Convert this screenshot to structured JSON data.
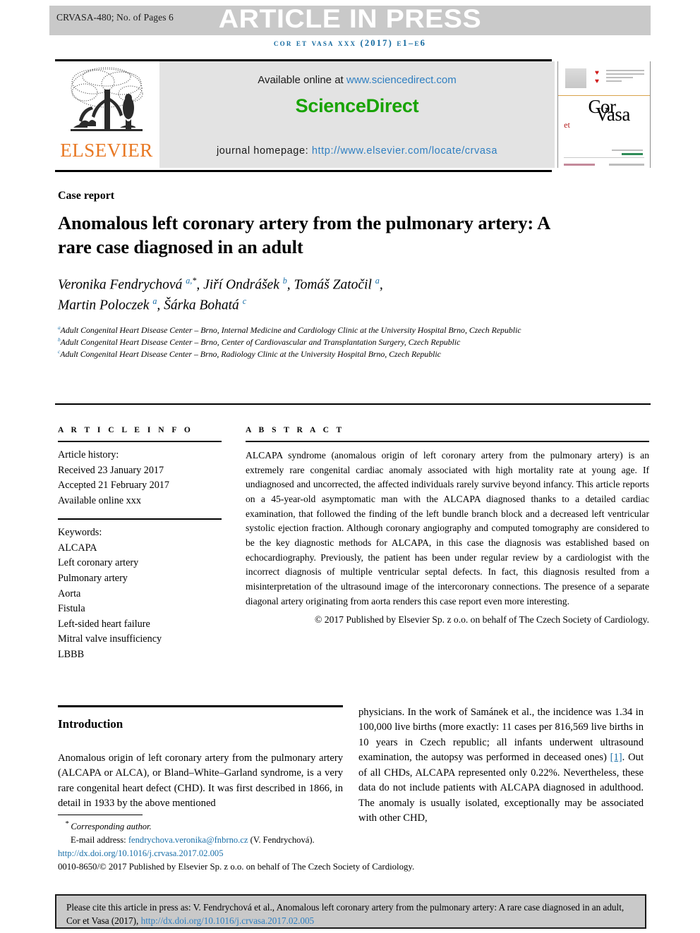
{
  "banner": {
    "article_id": "CRVASA-480; No. of Pages 6",
    "press_text": "ARTICLE IN PRESS",
    "journal_line": "COR ET VASA XXX (2017) e1–e6"
  },
  "masthead": {
    "publisher": "ELSEVIER",
    "available_prefix": "Available online at ",
    "available_url": "www.sciencedirect.com",
    "sciencedirect": "ScienceDirect",
    "homepage_label": "journal homepage: ",
    "homepage_url": "http://www.elsevier.com/locate/crvasa",
    "cover": {
      "cor": "Cor",
      "et": "et",
      "vasa": "Vasa"
    }
  },
  "article": {
    "type": "Case report",
    "title": "Anomalous left coronary artery from the pulmonary artery: A rare case diagnosed in an adult",
    "authors_line1_a": "Veronika Fendrychová ",
    "authors_line1_b": ", Jiří Ondrášek ",
    "authors_line1_c": ", Tomáš Zatočil ",
    "authors_line2_a": "Martin Poloczek ",
    "authors_line2_b": ", Šárka Bohatá ",
    "affiliations": [
      "Adult Congenital Heart Disease Center – Brno, Internal Medicine and Cardiology Clinic at the University Hospital Brno, Czech Republic",
      "Adult Congenital Heart Disease Center – Brno, Center of Cardiovascular and Transplantation Surgery, Czech Republic",
      "Adult Congenital Heart Disease Center – Brno, Radiology Clinic at the University Hospital Brno, Czech Republic"
    ]
  },
  "info": {
    "heading": "A R T I C L E   I N F O",
    "history_label": "Article history:",
    "received": "Received 23 January 2017",
    "accepted": "Accepted 21 February 2017",
    "available": "Available online xxx",
    "keywords_label": "Keywords:",
    "keywords": [
      "ALCAPA",
      "Left coronary artery",
      "Pulmonary artery",
      "Aorta",
      "Fistula",
      "Left-sided heart failure",
      "Mitral valve insufficiency",
      "LBBB"
    ]
  },
  "abstract": {
    "heading": "A B S T R A C T",
    "body": "ALCAPA syndrome (anomalous origin of left coronary artery from the pulmonary artery) is an extremely rare congenital cardiac anomaly associated with high mortality rate at young age. If undiagnosed and uncorrected, the affected individuals rarely survive beyond infancy. This article reports on a 45-year-old asymptomatic man with the ALCAPA diagnosed thanks to a detailed cardiac examination, that followed the finding of the left bundle branch block and a decreased left ventricular systolic ejection fraction. Although coronary angiography and computed tomography are considered to be the key diagnostic methods for ALCAPA, in this case the diagnosis was established based on echocardiography. Previously, the patient has been under regular review by a cardiologist with the incorrect diagnosis of multiple ventricular septal defects. In fact, this diagnosis resulted from a misinterpretation of the ultrasound image of the intercoronary connections. The presence of a separate diagonal artery originating from aorta renders this case report even more interesting.",
    "copyright": "© 2017 Published by Elsevier Sp. z o.o. on behalf of The Czech Society of Cardiology."
  },
  "body": {
    "intro_heading": "Introduction",
    "left_paragraph": "Anomalous origin of left coronary artery from the pulmonary artery (ALCAPA or ALCA), or Bland–White–Garland syndrome, is a very rare congenital heart defect (CHD). It was first described in 1866, in detail in 1933 by the above mentioned",
    "right_paragraph_a": "physicians. In the work of Samánek et al., the incidence was 1.34 in 100,000 live births (more exactly: 11 cases per 816,569 live births in 10 years in Czech republic; all infants underwent ultrasound examination, the autopsy was performed in deceased ones) ",
    "right_ref": "[1]",
    "right_paragraph_b": ". Out of all CHDs, ALCAPA represented only 0.22%. Nevertheless, these data do not include patients with ALCAPA diagnosed in adulthood. The anomaly is usually isolated, exceptionally may be associated with other CHD,"
  },
  "footnotes": {
    "corresponding": "Corresponding author.",
    "email_label": "E-mail address: ",
    "email": "fendrychova.veronika@fnbrno.cz",
    "email_suffix": " (V. Fendrychová).",
    "doi": "http://dx.doi.org/10.1016/j.crvasa.2017.02.005",
    "issn_line": "0010-8650/© 2017 Published by Elsevier Sp. z o.o. on behalf of The Czech Society of Cardiology."
  },
  "cite": {
    "text": "Please cite this article in press as: V. Fendrychová et al., Anomalous left coronary artery from the pulmonary artery: A rare case diagnosed in an adult, Cor et Vasa (2017), ",
    "link": "http://dx.doi.org/10.1016/j.crvasa.2017.02.005"
  },
  "colors": {
    "link_blue": "#2f7fc1",
    "ref_blue": "#1a6fa8",
    "sciencedirect_green": "#18a303",
    "elsevier_orange": "#e87722",
    "banner_gray": "#c9c9c9"
  }
}
